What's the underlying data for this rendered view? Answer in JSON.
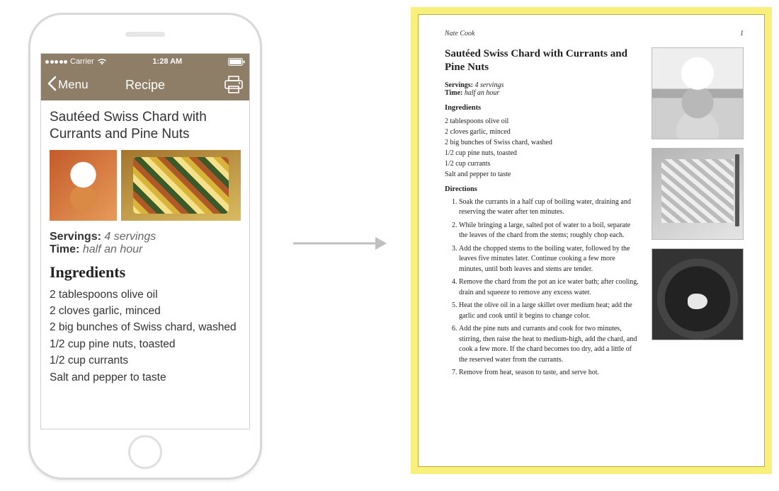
{
  "statusbar": {
    "carrier": "Carrier",
    "time": "1:28 AM"
  },
  "navbar": {
    "back_label": "Menu",
    "title": "Recipe"
  },
  "recipe": {
    "title": "Sautéed Swiss Chard with Currants and Pine Nuts",
    "servings_label": "Servings:",
    "servings_value": "4 servings",
    "time_label": "Time:",
    "time_value": "half an hour",
    "ingredients_heading": "Ingredients",
    "ingredients": [
      "2 tablespoons olive oil",
      "2 cloves garlic, minced",
      "2 big bunches of Swiss chard, washed",
      "1/2 cup pine nuts, toasted",
      "1/2 cup currants",
      "Salt and pepper to taste"
    ]
  },
  "print": {
    "author": "Nate Cook",
    "page_number": "1",
    "title": "Sautéed Swiss Chard with Currants and Pine Nuts",
    "servings_label": "Servings:",
    "servings_value": "4 servings",
    "time_label": "Time:",
    "time_value": "half an hour",
    "ingredients_heading": "Ingredients",
    "ingredients": [
      "2 tablespoons olive oil",
      "2 cloves garlic, minced",
      "2 big bunches of Swiss chard, washed",
      "1/2 cup pine nuts, toasted",
      "1/2 cup currants",
      "Salt and pepper to taste"
    ],
    "directions_heading": "Directions",
    "directions": [
      "Soak the currants in a half cup of boiling water, draining and reserving the water after ten minutes.",
      "While bringing a large, salted pot of water to a boil, separate the leaves of the chard from the stems; roughly chop each.",
      "Add the chopped stems to the boiling water, followed by the leaves five minutes later. Continue cooking a few more minutes, until both leaves and stems are tender.",
      "Remove the chard from the pot an ice water bath; after cooling, drain and squeeze to remove any excess water.",
      "Heat the olive oil in a large skillet over medium heat; add the garlic and cook until it begins to change color.",
      "Add the pine nuts and currants and cook for two minutes, stirring, then raise the heat to medium-high, add the chard, and cook a few more. If the chard becomes too dry, add a little of the reserved water from the currants.",
      "Remove from heat, season to taste, and serve hot."
    ]
  }
}
